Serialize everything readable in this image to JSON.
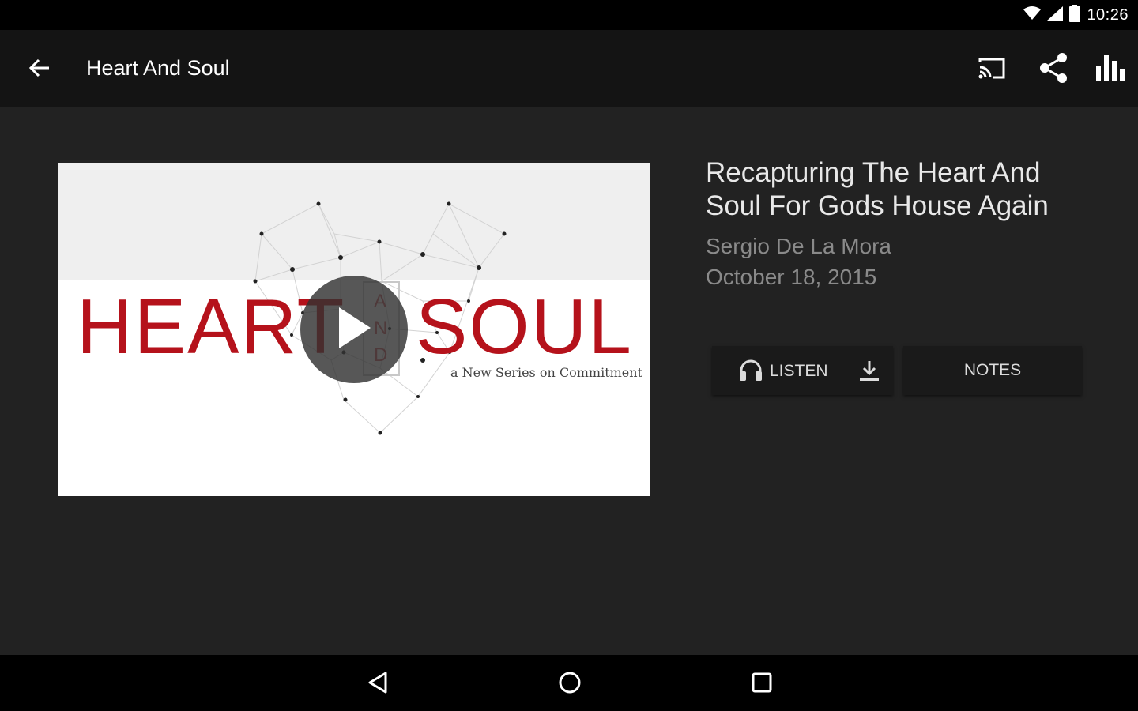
{
  "status_bar": {
    "time": "10:26",
    "icons": [
      "wifi-icon",
      "cell-signal-icon",
      "battery-icon"
    ]
  },
  "app_bar": {
    "title": "Heart And Soul",
    "back_icon": "arrow-left-icon",
    "actions": [
      "cast-icon",
      "share-icon",
      "equalizer-icon"
    ]
  },
  "artwork": {
    "word_left": "HEART",
    "word_right": "SOUL",
    "and_letters": [
      "A",
      "N",
      "D"
    ],
    "tagline": "a New Series on Commitment",
    "play_icon": "play-icon",
    "accent_color": "#b5121b"
  },
  "sermon": {
    "title": "Recapturing The Heart And Soul For Gods House Again",
    "speaker": "Sergio De La Mora",
    "date": "October 18, 2015"
  },
  "buttons": {
    "listen_label": "LISTEN",
    "listen_icon": "headphones-icon",
    "download_icon": "download-icon",
    "notes_label": "NOTES"
  },
  "nav_bar": [
    "back-triangle-icon",
    "home-circle-icon",
    "recents-square-icon"
  ]
}
